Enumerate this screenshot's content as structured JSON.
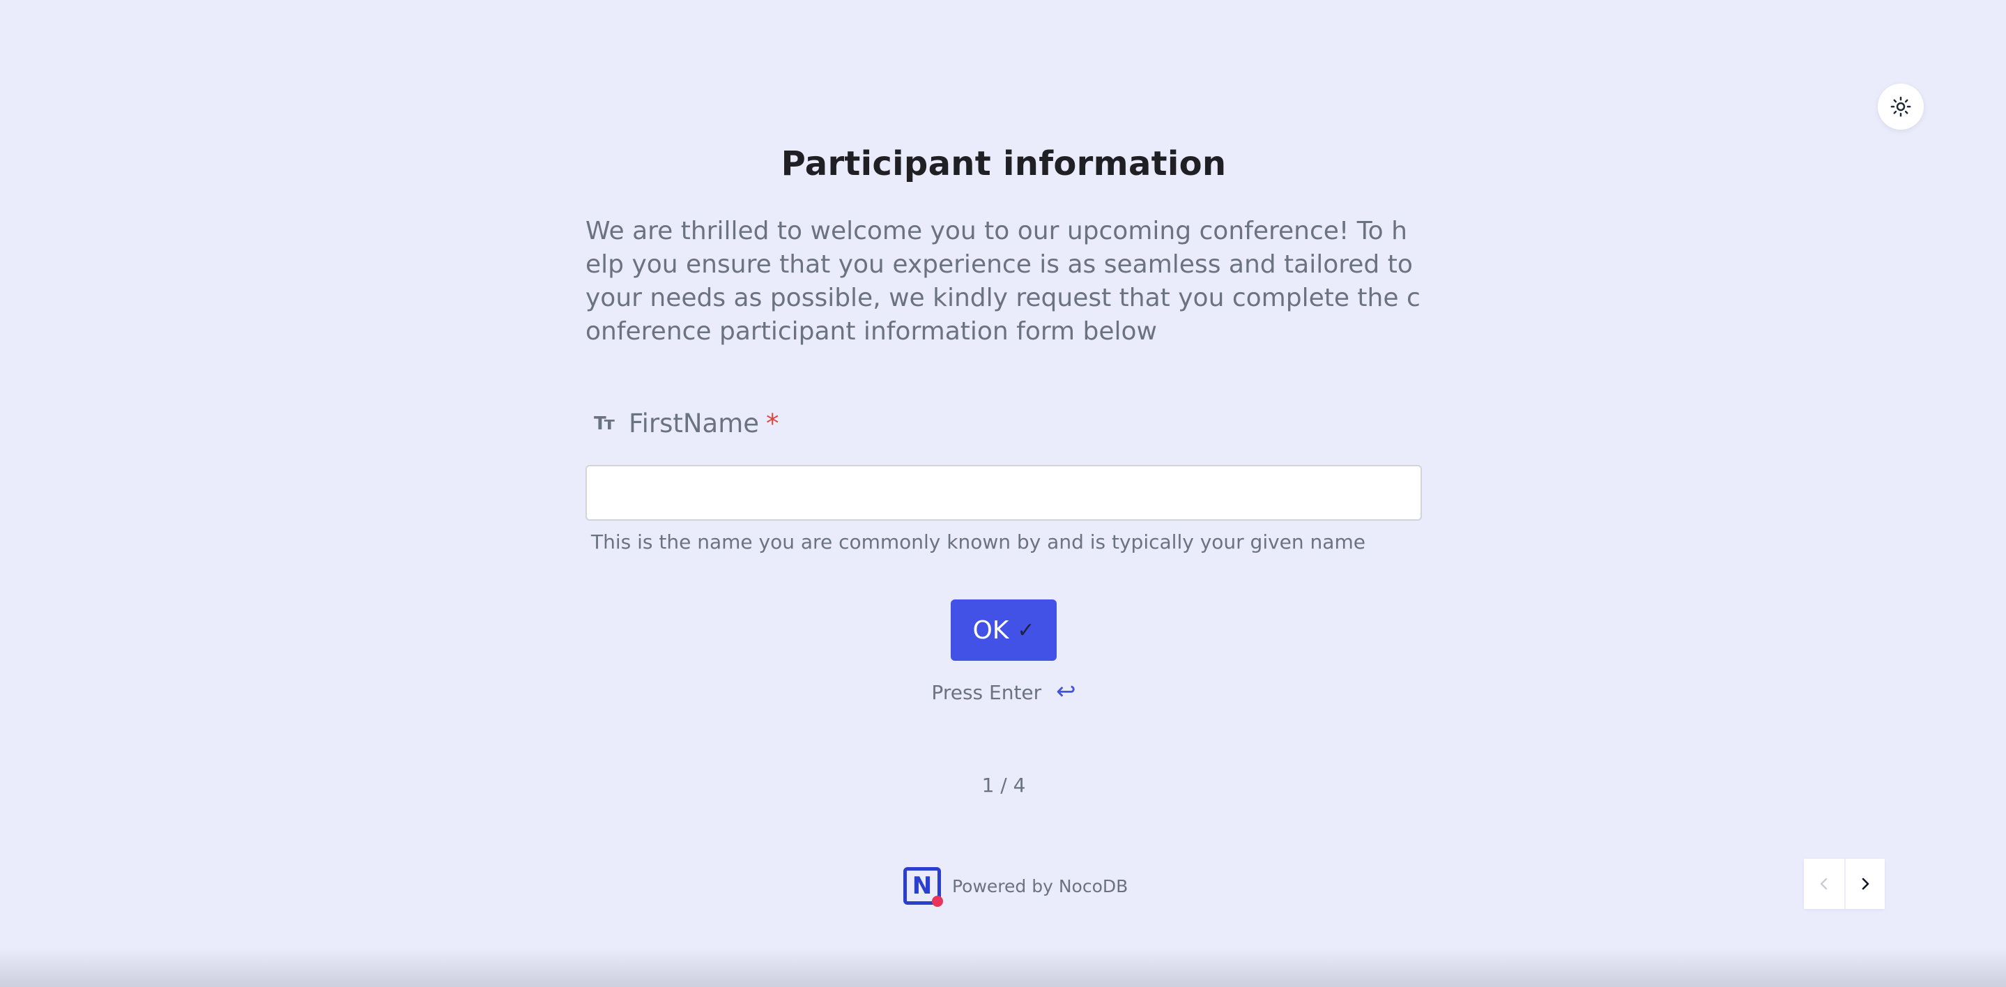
{
  "header": {
    "theme_toggle_icon": "sun-icon"
  },
  "form": {
    "title": "Participant information",
    "description": "We are thrilled to welcome you to our upcoming conference! To help you ensure that you experience is as seamless and tailored to your needs as possible, we kindly request that you complete the conference participant information form below",
    "field": {
      "type_icon": "Tт",
      "label": "FirstName",
      "required_mark": "*",
      "value": "",
      "placeholder": "",
      "helper": "This is the name you are commonly known by and is typically your given name"
    },
    "ok_label": "OK",
    "ok_check": "✓",
    "press_enter": "Press Enter",
    "enter_icon": "↩",
    "pager": "1 / 4"
  },
  "footer": {
    "logo_letter": "N",
    "powered_by": "Powered by NocoDB"
  },
  "colors": {
    "background": "#eaecfb",
    "accent": "#4352e6",
    "required": "#e2453e"
  }
}
